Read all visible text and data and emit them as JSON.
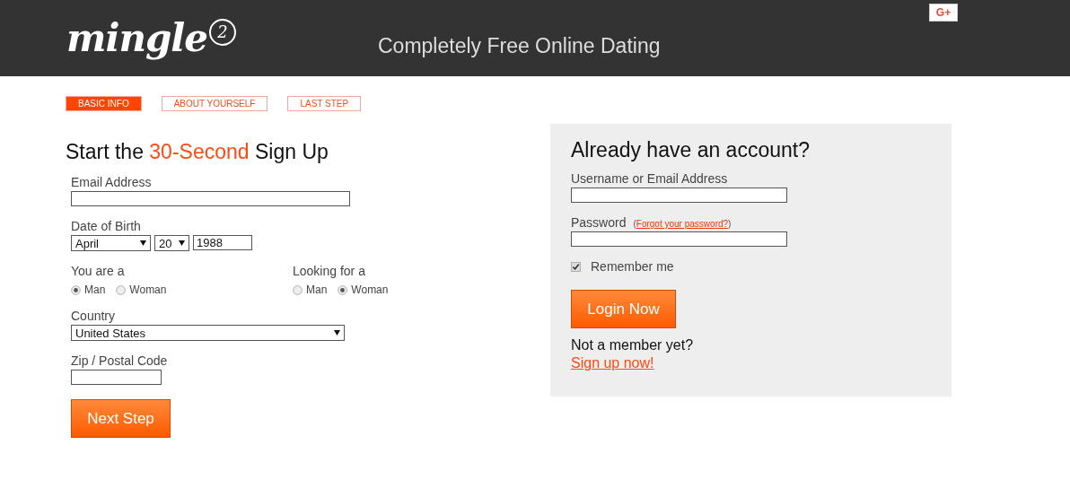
{
  "header": {
    "logo": {
      "text": "mingle",
      "badge": "2"
    },
    "tagline": "Completely Free Online Dating",
    "social_button": "G+"
  },
  "steps": [
    {
      "label": "BASIC INFO",
      "selected": true
    },
    {
      "label": "ABOUT YOURSELF",
      "selected": false
    },
    {
      "label": "LAST STEP",
      "selected": false
    }
  ],
  "signup": {
    "title": {
      "before": "Start the ",
      "highlight": "30-Second",
      "after": " Sign Up"
    },
    "email": {
      "label": "Email Address"
    },
    "birth": {
      "label": "Date of Birth",
      "month": "April",
      "day": "20",
      "year": "1988"
    },
    "you_are": {
      "label": "You are a",
      "options": [
        {
          "label": "Man",
          "selected": true
        },
        {
          "label": "Woman",
          "selected": false
        }
      ]
    },
    "looking_for": {
      "label": "Looking for a",
      "options": [
        {
          "label": "Man",
          "selected": false
        },
        {
          "label": "Woman",
          "selected": true
        }
      ]
    },
    "country": {
      "label": "Country",
      "value": "United States"
    },
    "zip": {
      "label": "Zip / Postal Code"
    },
    "next_button": "Next Step"
  },
  "login": {
    "title": "Already have an account?",
    "username": {
      "label": "Username or Email Address"
    },
    "password": {
      "label": "Password",
      "forgot": {
        "prefix": "(",
        "link": "Forgot your password?",
        "suffix": ")"
      }
    },
    "remember": {
      "label": "Remember me",
      "checked": true
    },
    "login_button": "Login Now",
    "not_member": "Not a member yet?",
    "signup_link": "Sign up now!"
  }
}
